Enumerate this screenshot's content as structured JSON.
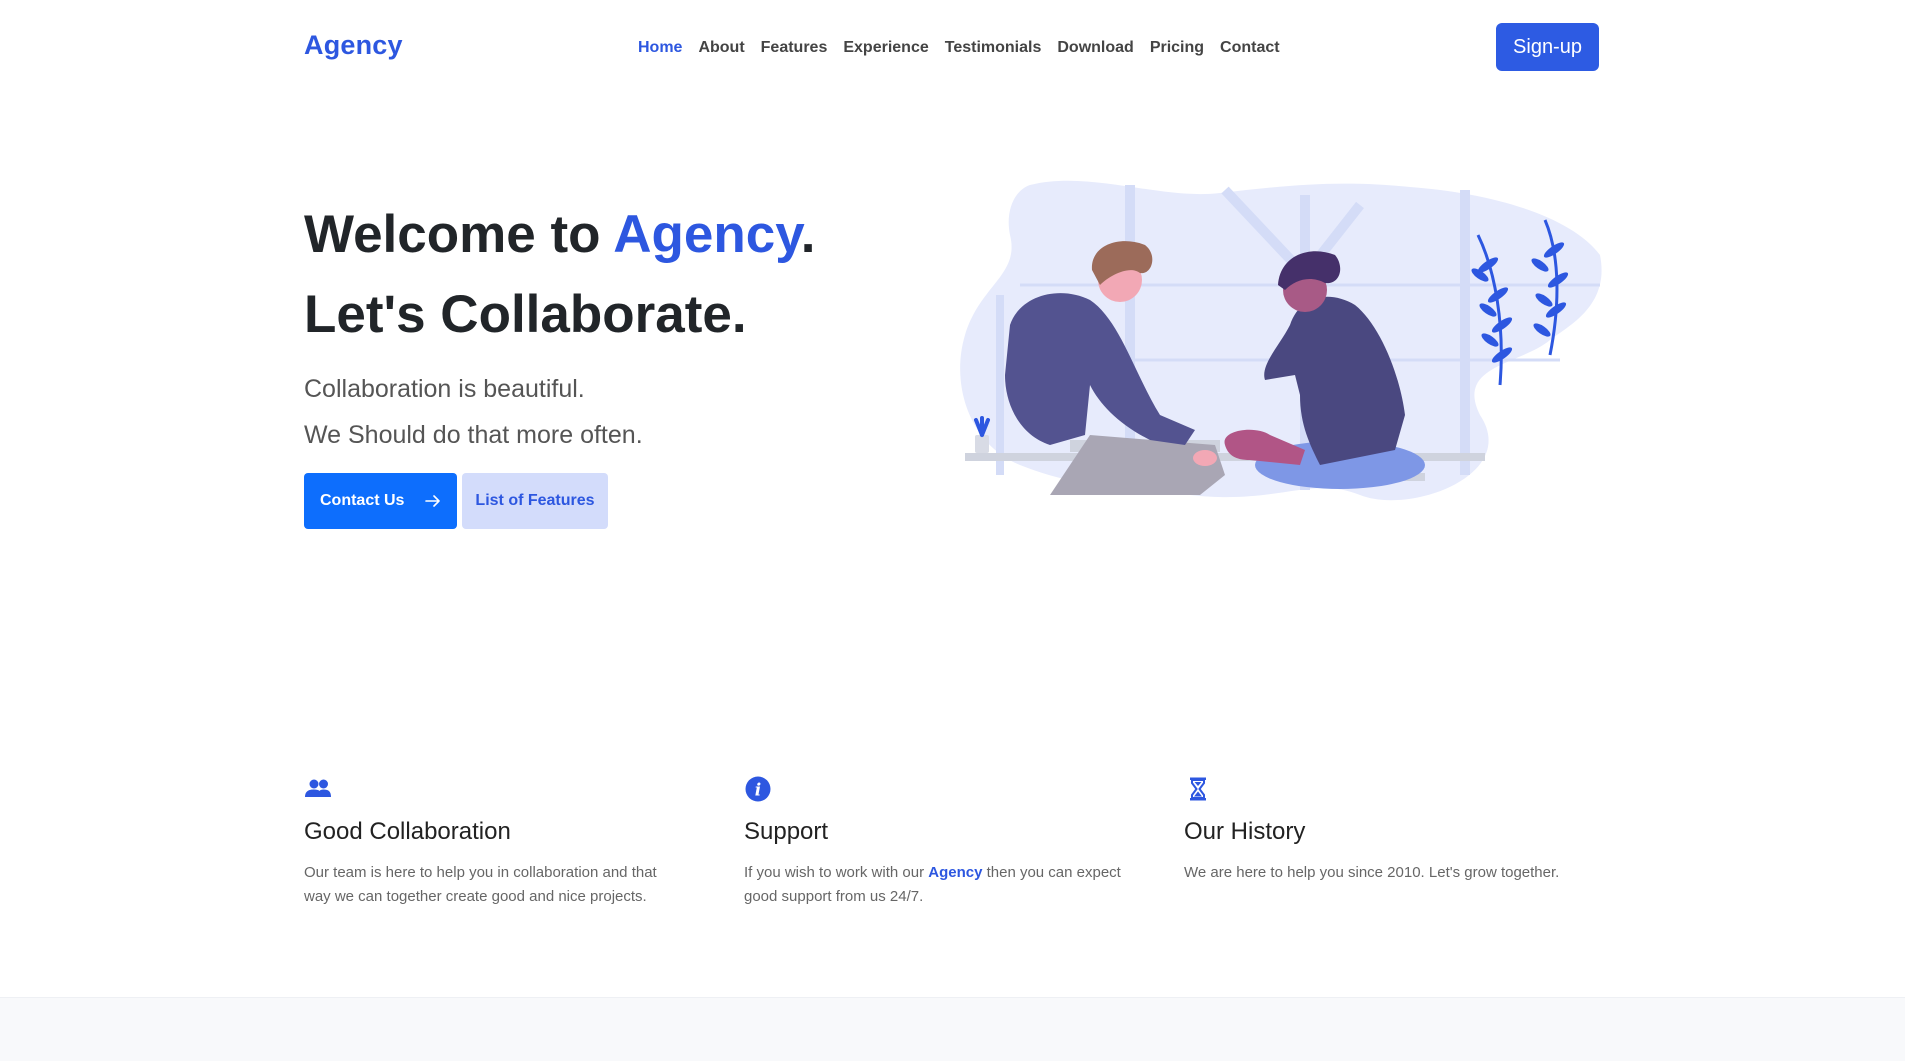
{
  "brand": "Agency",
  "nav": {
    "items": [
      "Home",
      "About",
      "Features",
      "Experience",
      "Testimonials",
      "Download",
      "Pricing",
      "Contact"
    ],
    "active": "Home"
  },
  "signup_label": "Sign-up",
  "hero": {
    "title_prefix": "Welcome to ",
    "title_accent": "Agency",
    "title_suffix": ".",
    "title_line2": "Let's Collaborate.",
    "subtitle_line1": "Collaboration is beautiful.",
    "subtitle_line2": "We Should do that more often.",
    "primary_button": "Contact Us",
    "primary_button_icon": "arrow-right-icon",
    "secondary_button": "List of Features"
  },
  "features": [
    {
      "icon": "people-icon",
      "title": "Good Collaboration",
      "text": "Our team is here to help you in collaboration and that way we can together create good and nice projects."
    },
    {
      "icon": "info-icon",
      "title": "Support",
      "text_before": "If you wish to work with our ",
      "text_highlight": "Agency",
      "text_after": " then you can expect good support from us 24/7."
    },
    {
      "icon": "hourglass-icon",
      "title": "Our History",
      "text": "We are here to help you since 2010. Let's grow together."
    }
  ],
  "colors": {
    "accent": "#2d57e0",
    "primary_button": "#0d6efd",
    "secondary_button_bg": "#d3dcfb"
  }
}
